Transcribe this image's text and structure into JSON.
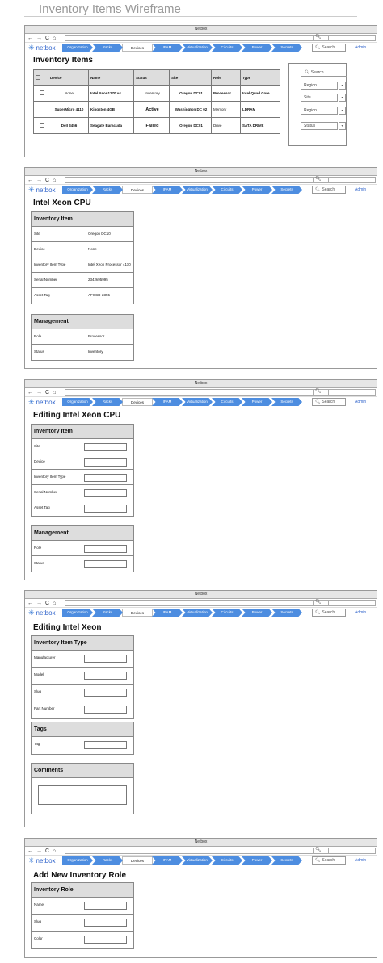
{
  "page_title": "Inventory Items Wireframe",
  "browser": {
    "title": "Netbox",
    "nav_buttons": [
      "←",
      "→",
      "C",
      "⌂"
    ]
  },
  "nav": {
    "logo": "netbox",
    "tabs": [
      "Organization",
      "Racks",
      "Devices",
      "IPAM",
      "Virtualization",
      "Circuits",
      "Power",
      "Secrets"
    ],
    "active_tab": "Devices",
    "search_placeholder": "Search",
    "admin": "Admin"
  },
  "frame1": {
    "heading": "Inventory Items",
    "columns": [
      "",
      "Device",
      "Name",
      "Status",
      "Site",
      "Role",
      "Type"
    ],
    "rows": [
      {
        "device": "None",
        "name": "Intel Xeon1270 v4",
        "status": "Inventory",
        "site": "Oregon DC01",
        "role": "Processor",
        "type": "Intel Quad Core"
      },
      {
        "device": "SuperMicro 4110",
        "name": "Kingston 4GB",
        "status": "Active",
        "site": "Washington DC 02",
        "role": "Memory",
        "type": "LDRAM"
      },
      {
        "device": "Dell 3456",
        "name": "Seagate Baracuda",
        "status": "Failed",
        "site": "Oregon DC01",
        "role": "Drive",
        "type": "SATA DRIVE"
      }
    ],
    "filters": {
      "search": "Search",
      "selects": [
        "Region",
        "Site",
        "Region",
        "Status"
      ]
    }
  },
  "frame2": {
    "heading": "Intel Xeon CPU",
    "panel1": {
      "title": "Inventory Item",
      "rows": [
        {
          "label": "Site",
          "value": "Oregon DC10"
        },
        {
          "label": "Device",
          "value": "None"
        },
        {
          "label": "Inventory Item Type",
          "value": "Intel Xeon Processor 4110"
        },
        {
          "label": "Serial Number",
          "value": "2342k95995"
        },
        {
          "label": "Asset Tag",
          "value": "AFCCD-2355"
        }
      ]
    },
    "panel2": {
      "title": "Management",
      "rows": [
        {
          "label": "Role",
          "value": "Processor"
        },
        {
          "label": "Status",
          "value": "Inventory"
        }
      ]
    }
  },
  "frame3": {
    "heading": "Editing Intel Xeon CPU",
    "panel1": {
      "title": "Inventory Item",
      "fields": [
        "Site",
        "Device",
        "Inventory Item Type",
        "Serial Number",
        "Asset Tag"
      ]
    },
    "panel2": {
      "title": "Management",
      "fields": [
        "Role",
        "Status"
      ]
    }
  },
  "frame4": {
    "heading": "Editing Intel Xeon",
    "panel1": {
      "title": "Inventory Item Type",
      "fields": [
        "Manufacturer",
        "Model",
        "Slug",
        "Part Number"
      ]
    },
    "panel2": {
      "title": "Tags",
      "fields": [
        "Tag"
      ]
    },
    "panel3": {
      "title": "Comments"
    }
  },
  "frame5": {
    "heading": "Add New Inventory Role",
    "panel1": {
      "title": "Inventory Role",
      "fields": [
        "Name",
        "Slug",
        "Color"
      ]
    }
  }
}
